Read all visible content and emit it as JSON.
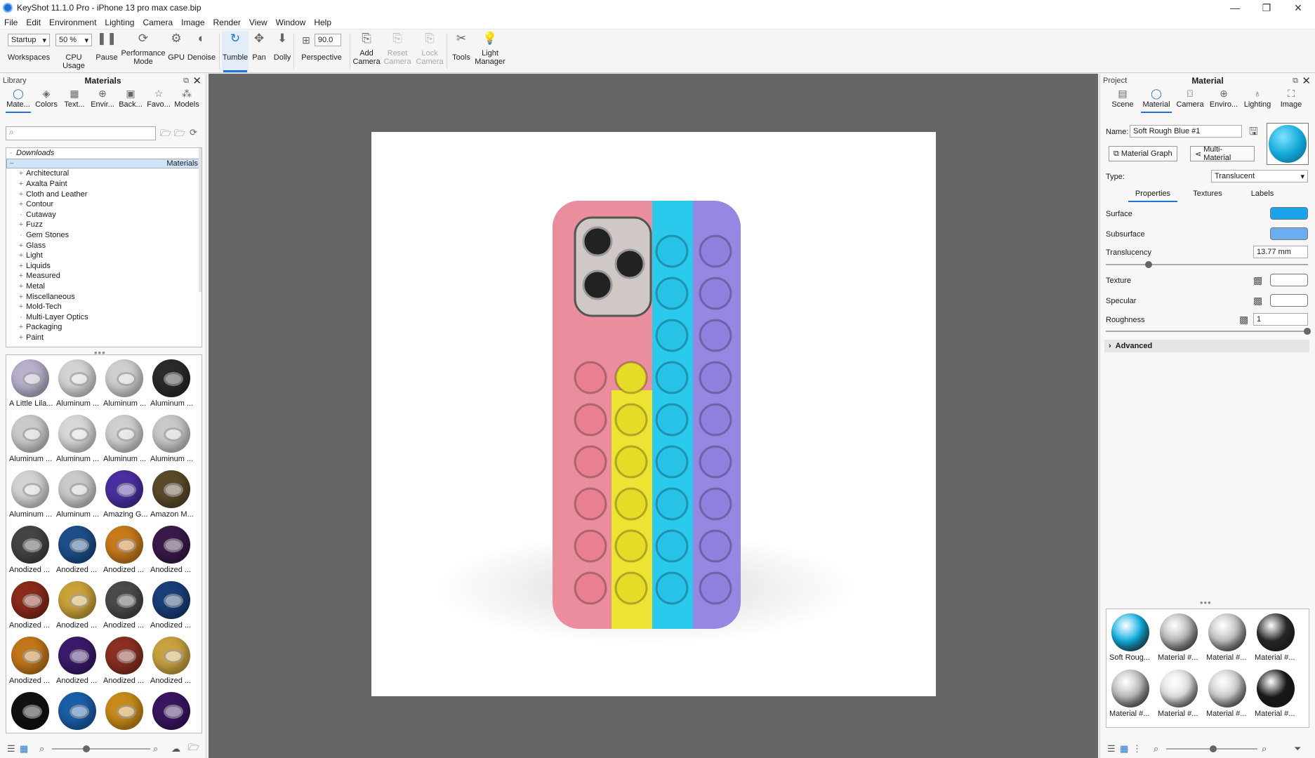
{
  "window": {
    "title": "KeyShot 11.1.0 Pro  - iPhone 13 pro max case.bip"
  },
  "menu": [
    "File",
    "Edit",
    "Environment",
    "Lighting",
    "Camera",
    "Image",
    "Render",
    "View",
    "Window",
    "Help"
  ],
  "toolbar": {
    "workspace_value": "Startup",
    "cpu_value": "50 %",
    "fov_value": "90.0",
    "items": {
      "workspaces": "Workspaces",
      "cpu": "CPU Usage",
      "pause": "Pause",
      "performance": "Performance\nMode",
      "gpu": "GPU",
      "denoise": "Denoise",
      "tumble": "Tumble",
      "pan": "Pan",
      "dolly": "Dolly",
      "perspective": "Perspective",
      "add_camera": "Add\nCamera",
      "reset_camera": "Reset\nCamera",
      "lock_camera": "Lock\nCamera",
      "tools": "Tools",
      "light_manager": "Light\nManager"
    }
  },
  "library": {
    "header_left": "Library",
    "header_title": "Materials",
    "tabs": [
      "Mate...",
      "Colors",
      "Text...",
      "Envir...",
      "Back...",
      "Favo...",
      "Models"
    ],
    "search_placeholder": "",
    "tree": [
      {
        "label": "Downloads",
        "pm": "",
        "italic": true
      },
      {
        "label": "Materials",
        "pm": "−",
        "selected": true
      },
      {
        "label": "Architectural",
        "pm": "+",
        "indent": 1
      },
      {
        "label": "Axalta Paint",
        "pm": "+",
        "indent": 1
      },
      {
        "label": "Cloth and Leather",
        "pm": "+",
        "indent": 1
      },
      {
        "label": "Contour",
        "pm": "+",
        "indent": 1
      },
      {
        "label": "Cutaway",
        "pm": "",
        "indent": 1
      },
      {
        "label": "Fuzz",
        "pm": "+",
        "indent": 1
      },
      {
        "label": "Gem Stones",
        "pm": "",
        "indent": 1
      },
      {
        "label": "Glass",
        "pm": "+",
        "indent": 1
      },
      {
        "label": "Light",
        "pm": "+",
        "indent": 1
      },
      {
        "label": "Liquids",
        "pm": "+",
        "indent": 1
      },
      {
        "label": "Measured",
        "pm": "+",
        "indent": 1
      },
      {
        "label": "Metal",
        "pm": "+",
        "indent": 1
      },
      {
        "label": "Miscellaneous",
        "pm": "+",
        "indent": 1
      },
      {
        "label": "Mold-Tech",
        "pm": "+",
        "indent": 1
      },
      {
        "label": "Multi-Layer Optics",
        "pm": "",
        "indent": 1
      },
      {
        "label": "Packaging",
        "pm": "+",
        "indent": 1
      },
      {
        "label": "Paint",
        "pm": "+",
        "indent": 1
      }
    ],
    "thumbs": [
      {
        "label": "A Little Lila...",
        "color": "#b8b0cc"
      },
      {
        "label": "Aluminum ...",
        "color": "#d4d4d4"
      },
      {
        "label": "Aluminum ...",
        "color": "#cfcfcf"
      },
      {
        "label": "Aluminum ...",
        "color": "#2a2a2a"
      },
      {
        "label": "Aluminum ...",
        "color": "#cbcbcb"
      },
      {
        "label": "Aluminum ...",
        "color": "#d8d8d8"
      },
      {
        "label": "Aluminum ...",
        "color": "#d0d0d0"
      },
      {
        "label": "Aluminum ...",
        "color": "#c9c9c9"
      },
      {
        "label": "Aluminum ...",
        "color": "#d3d3d3"
      },
      {
        "label": "Aluminum ...",
        "color": "#cacaca"
      },
      {
        "label": "Amazing G...",
        "color": "#4a2fa0"
      },
      {
        "label": "Amazon M...",
        "color": "#5a4a2a"
      },
      {
        "label": "Anodized ...",
        "color": "#444444"
      },
      {
        "label": "Anodized ...",
        "color": "#1c4f8a"
      },
      {
        "label": "Anodized ...",
        "color": "#c77a1c"
      },
      {
        "label": "Anodized ...",
        "color": "#3a1a4a"
      },
      {
        "label": "Anodized ...",
        "color": "#8a2a1a"
      },
      {
        "label": "Anodized ...",
        "color": "#c9a23a"
      },
      {
        "label": "Anodized ...",
        "color": "#4a4a4a"
      },
      {
        "label": "Anodized ...",
        "color": "#1a3e7a"
      },
      {
        "label": "Anodized ...",
        "color": "#c2761a"
      },
      {
        "label": "Anodized ...",
        "color": "#3a1a6a"
      },
      {
        "label": "Anodized ...",
        "color": "#8a2f22"
      },
      {
        "label": "Anodized ...",
        "color": "#c9a140"
      },
      {
        "label": "",
        "color": "#111111"
      },
      {
        "label": "",
        "color": "#1a5ea8"
      },
      {
        "label": "",
        "color": "#c88a1a"
      },
      {
        "label": "",
        "color": "#3a1560"
      }
    ]
  },
  "project": {
    "header_left": "Project",
    "header_title": "Material",
    "tabs": [
      "Scene",
      "Material",
      "Camera",
      "Enviro...",
      "Lighting",
      "Image"
    ],
    "name_label": "Name:",
    "name_value": "Soft Rough Blue #1",
    "material_graph": "Material Graph",
    "multi_material": "Multi-Material",
    "type_label": "Type:",
    "type_value": "Translucent",
    "subtabs": [
      "Properties",
      "Textures",
      "Labels"
    ],
    "surface_label": "Surface",
    "surface_color": "#1aa3ea",
    "subsurface_label": "Subsurface",
    "subsurface_color": "#6aaef0",
    "translucency_label": "Translucency",
    "translucency_value": "13.77 mm",
    "texture_label": "Texture",
    "specular_label": "Specular",
    "roughness_label": "Roughness",
    "roughness_value": "1",
    "advanced_label": "Advanced",
    "thumbs": [
      {
        "label": "Soft Roug...",
        "color": "#14b4e6"
      },
      {
        "label": "Material #...",
        "color": "#b9b9b9"
      },
      {
        "label": "Material #...",
        "color": "#c3c3c3"
      },
      {
        "label": "Material #...",
        "color": "#2a2a2a"
      },
      {
        "label": "Material #...",
        "color": "#bdbdbd"
      },
      {
        "label": "Material #...",
        "color": "#e2e2e2"
      },
      {
        "label": "Material #...",
        "color": "#cfcfcf"
      },
      {
        "label": "Material #...",
        "color": "#1a1a1a"
      }
    ]
  }
}
